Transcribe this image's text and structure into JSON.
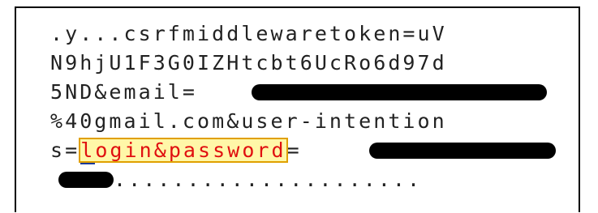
{
  "text_view": {
    "line1": ".y...csrfmiddlewaretoken=uV",
    "line2": "N9hjU1F3G0IZHtcbt6UcRo6d97d",
    "line3_prefix": "5ND&email=",
    "line4": "%40gmail.com&user-intention",
    "line5_prefix": "s=",
    "line5_highlight_first": "l",
    "line5_highlight_rest": "ogin&password",
    "line5_suffix": "=",
    "line6_suffix": "....................."
  },
  "colors": {
    "highlight_background": "#fff7a8",
    "highlight_text": "#e01010",
    "highlight_border": "#e0a000",
    "cursor_underline": "#1a3a9a",
    "redaction": "#000000"
  }
}
